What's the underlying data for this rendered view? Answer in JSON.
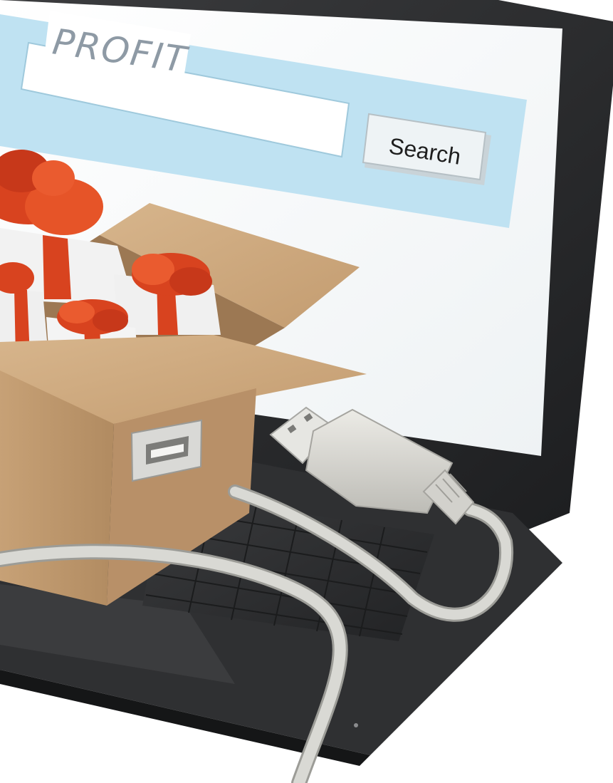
{
  "scene": {
    "profit_text": "PROFIT",
    "search_button_label": "Search"
  },
  "colors": {
    "laptop_bezel": "#2a2b2d",
    "screen_bg": "#f6f8f9",
    "search_bar_bg": "#bfe2f2",
    "cardboard": "#c9a57c",
    "cardboard_dark": "#a9845b",
    "ribbon": "#d8431f",
    "gift_white": "#f2f2f2",
    "cable": "#d4d4cf"
  },
  "icons": [
    "laptop",
    "search-input",
    "search-button",
    "cardboard-box",
    "gift-box",
    "usb-plug",
    "usb-port",
    "cable"
  ]
}
